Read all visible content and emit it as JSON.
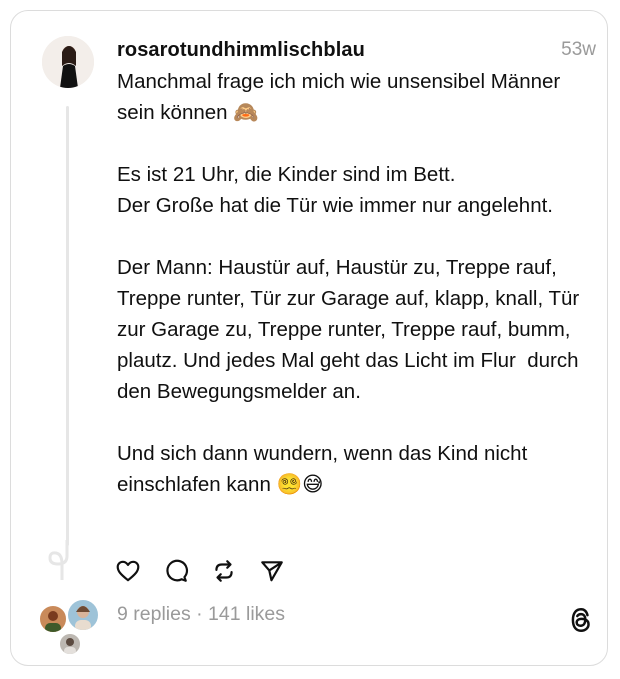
{
  "post": {
    "username": "rosarotundhimmlischblau",
    "timestamp": "53w",
    "text": "Manchmal frage ich mich wie unsensibel Männer sein können 🙈\n\nEs ist 21 Uhr, die Kinder sind im Bett.\nDer Große hat die Tür wie immer nur angelehnt.\n\nDer Mann: Haustür auf, Haustür zu, Treppe rauf, Treppe runter, Tür zur Garage auf, klapp, knall, Tür zur Garage zu, Treppe runter, Treppe rauf, bumm, plautz. Und jedes Mal geht das Licht im Flur  durch den Bewegungsmelder an.\n\nUnd sich dann wundern, wenn das Kind nicht einschlafen kann 😵‍💫😅",
    "stats": "9 replies · 141 likes"
  },
  "icons": {
    "like": "heart-icon",
    "reply": "comment-icon",
    "repost": "repost-icon",
    "share": "send-icon",
    "brand": "threads-logo-icon"
  }
}
